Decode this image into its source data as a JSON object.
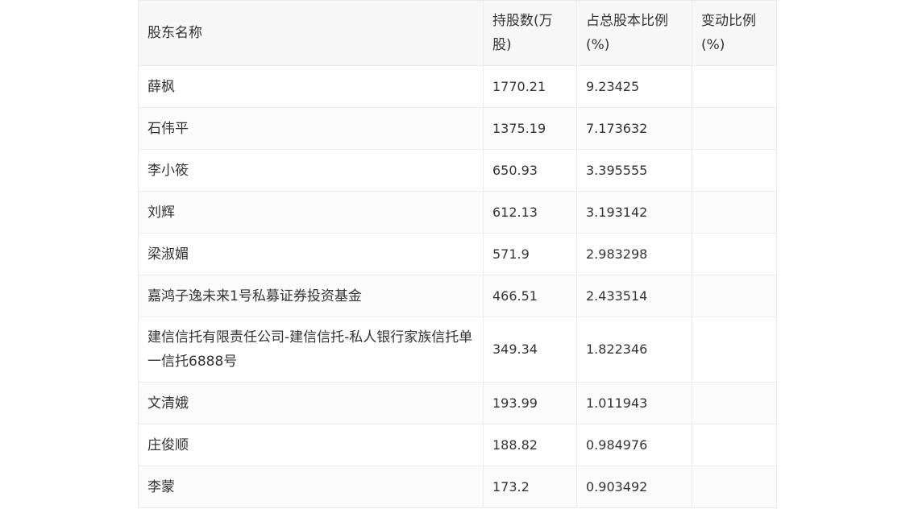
{
  "table": {
    "headers": [
      "股东名称",
      "持股数(万股)",
      "占总股本比例(%)",
      "变动比例(%)"
    ],
    "rows": [
      [
        "薛枫",
        "1770.21",
        "9.23425",
        ""
      ],
      [
        "石伟平",
        "1375.19",
        "7.173632",
        ""
      ],
      [
        "李小筱",
        "650.93",
        "3.395555",
        ""
      ],
      [
        "刘辉",
        "612.13",
        "3.193142",
        ""
      ],
      [
        "梁淑媚",
        "571.9",
        "2.983298",
        ""
      ],
      [
        "嘉鸿子逸未来1号私募证券投资基金",
        "466.51",
        "2.433514",
        ""
      ],
      [
        "建信信托有限责任公司-建信信托-私人银行家族信托单一信托6888号",
        "349.34",
        "1.822346",
        ""
      ],
      [
        "文清娥",
        "193.99",
        "1.011943",
        ""
      ],
      [
        "庄俊顺",
        "188.82",
        "0.984976",
        ""
      ],
      [
        "李蒙",
        "173.2",
        "0.903492",
        ""
      ]
    ]
  }
}
